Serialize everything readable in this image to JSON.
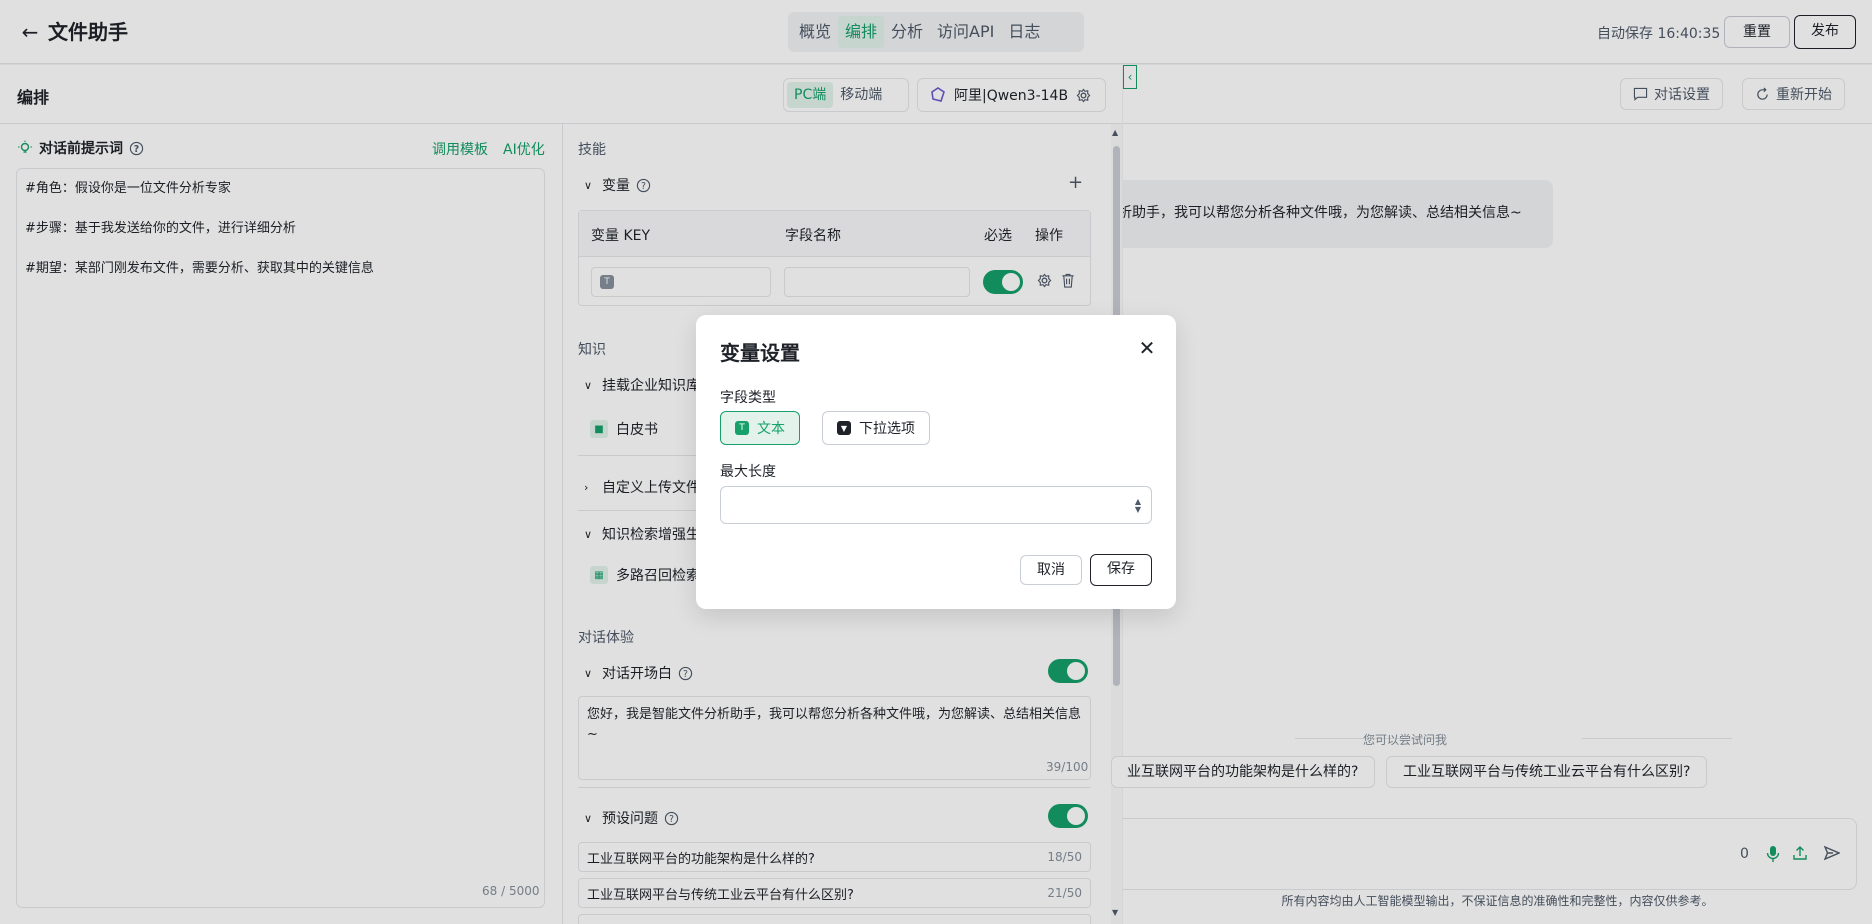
{
  "header": {
    "back_icon": "arrow-left-icon",
    "title": "文件助手",
    "tabs": [
      {
        "label": "概览",
        "active": false
      },
      {
        "label": "编排",
        "active": true
      },
      {
        "label": "分析",
        "active": false
      },
      {
        "label": "访问API",
        "active": false
      },
      {
        "label": "日志",
        "active": false
      }
    ],
    "autosave": "自动保存 16:40:35",
    "reset_label": "重置",
    "publish_label": "发布"
  },
  "editor": {
    "section_title": "编排",
    "device_tabs": [
      "PC端",
      "移动端"
    ],
    "active_device": "PC端",
    "model_label": "阿里|Qwen3-14B"
  },
  "prompt": {
    "title": "对话前提示词",
    "template_link": "调用模板",
    "ai_optimize_link": "AI优化",
    "lines": [
      "#角色：假设你是一位文件分析专家",
      "#步骤：基于我发送给你的文件，进行详细分析",
      "#期望：某部门刚发布文件，需要分析、获取其中的关键信息"
    ],
    "char_count": "68 / 5000"
  },
  "skills": {
    "heading": "技能",
    "variables_label": "变量",
    "columns": [
      "变量 KEY",
      "字段名称",
      "必选",
      "操作"
    ],
    "knowledge_heading": "知识",
    "kb_mount_label": "挂载企业知识库",
    "kb_item": "白皮书",
    "custom_upload_label": "自定义上传文件",
    "retrieval_label": "知识检索增强生",
    "retrieval_item": "多路召回检索",
    "experience_heading": "对话体验",
    "opening_label": "对话开场白",
    "opening_text": "您好，我是智能文件分析助手，我可以帮您分析各种文件哦，为您解读、总结相关信息~",
    "opening_count": "39/100",
    "preset_label": "预设问题",
    "preset_questions": [
      {
        "text": "工业互联网平台的功能架构是什么样的?",
        "count": "18/50"
      },
      {
        "text": "工业互联网平台与传统工业云平台有什么区别?",
        "count": "21/50"
      }
    ]
  },
  "preview": {
    "chat_settings_label": "对话设置",
    "restart_label": "重新开始",
    "bubble_text": "析助手，我可以帮您分析各种文件哦，为您解读、总结相关信息~",
    "try_label": "您可以尝试问我",
    "suggestions": [
      "业互联网平台的功能架构是什么样的?",
      "工业互联网平台与传统工业云平台有什么区别?"
    ],
    "input_count": "0",
    "disclaimer": "所有内容均由人工智能模型输出，不保证信息的准确性和完整性，内容仅供参考。"
  },
  "modal": {
    "title": "变量设置",
    "field_type_label": "字段类型",
    "type_options": [
      {
        "label": "文本",
        "selected": true
      },
      {
        "label": "下拉选项",
        "selected": false
      }
    ],
    "max_length_label": "最大长度",
    "max_length_value": "",
    "cancel_label": "取消",
    "save_label": "保存"
  },
  "colors": {
    "accent": "#16a06a",
    "accent_light": "#e3f3ec",
    "text": "#1f2329",
    "muted": "#86909c"
  }
}
